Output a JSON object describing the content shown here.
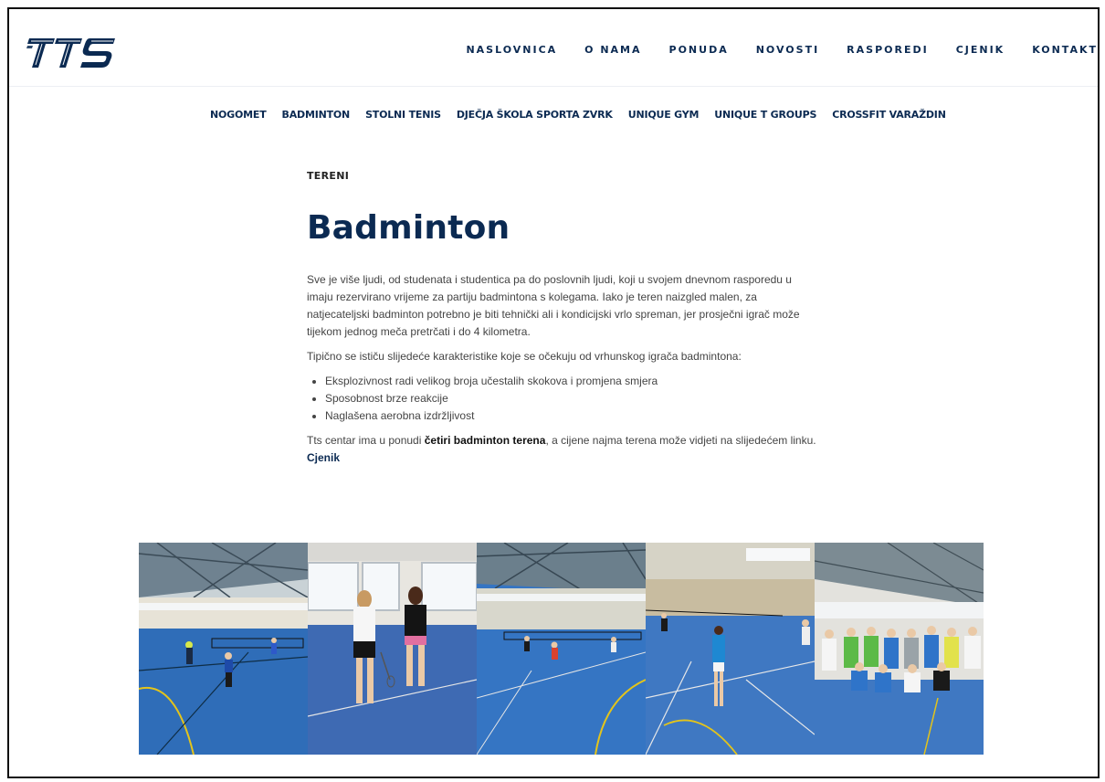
{
  "brand": {
    "logo_text": "TTS"
  },
  "main_nav": [
    {
      "label": "NASLOVNICA"
    },
    {
      "label": "O NAMA"
    },
    {
      "label": "PONUDA"
    },
    {
      "label": "NOVOSTI"
    },
    {
      "label": "RASPOREDI"
    },
    {
      "label": "CJENIK"
    },
    {
      "label": "KONTAKT"
    }
  ],
  "sub_nav": [
    {
      "label": "NOGOMET"
    },
    {
      "label": "BADMINTON"
    },
    {
      "label": "STOLNI TENIS"
    },
    {
      "label": "DJEČJA ŠKOLA SPORTA ZVRK"
    },
    {
      "label": "UNIQUE GYM"
    },
    {
      "label": "UNIQUE T GROUPS"
    },
    {
      "label": "CROSSFIT VARAŽDIN"
    }
  ],
  "content": {
    "eyebrow": "TERENI",
    "title": "Badminton",
    "paragraph1": "Sve je više ljudi, od studenata i studentica pa do poslovnih ljudi, koji u svojem dnevnom rasporedu u  imaju rezervirano vrijeme za partiju badmintona s kolegama. Iako je teren naizgled malen, za natjecateljski badminton potrebno je biti tehnički ali i kondicijski vrlo spreman, jer prosječni igrač može tijekom jednog meča pretrčati i do 4 kilometra.",
    "paragraph2": "Tipično se ističu slijedeće karakteristike koje se očekuju od vrhunskog igrača badmintona:",
    "features": [
      "Eksplozivnost radi velikog broja učestalih skokova i promjena smjera",
      "Sposobnost brze reakcije",
      "Naglašena aerobna izdržljivost"
    ],
    "paragraph3_before": "Tts centar ima u ponudi ",
    "paragraph3_bold": "četiri badminton terena",
    "paragraph3_after": ", a cijene najma terena može vidjeti na slijedećem linku. ",
    "paragraph3_link": "Cjenik"
  },
  "colors": {
    "brand_navy": "#0b2a52",
    "court_blue": "#2f6db8"
  }
}
